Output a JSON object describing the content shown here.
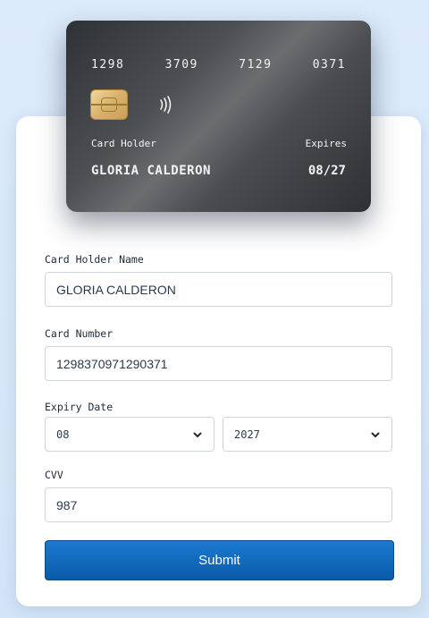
{
  "card": {
    "number_groups": [
      "1298",
      "3709",
      "7129",
      "0371"
    ],
    "holder_label": "Card Holder",
    "holder_name": "GLORIA CALDERON",
    "expires_label": "Expires",
    "expiry": "08/27"
  },
  "form": {
    "holder_name_label": "Card Holder Name",
    "holder_name_value": "GLORIA CALDERON",
    "card_number_label": "Card Number",
    "card_number_value": "1298370971290371",
    "expiry_label": "Expiry Date",
    "expiry_month": "08",
    "expiry_year": "2027",
    "cvv_label": "CVV",
    "cvv_value": "987",
    "submit_label": "Submit"
  },
  "colors": {
    "button": "#0b5aa8",
    "background": "#d6e7f8",
    "card": "#4a4d4f"
  },
  "icons": [
    "chip-icon",
    "contactless-icon",
    "chevron-down-icon"
  ]
}
